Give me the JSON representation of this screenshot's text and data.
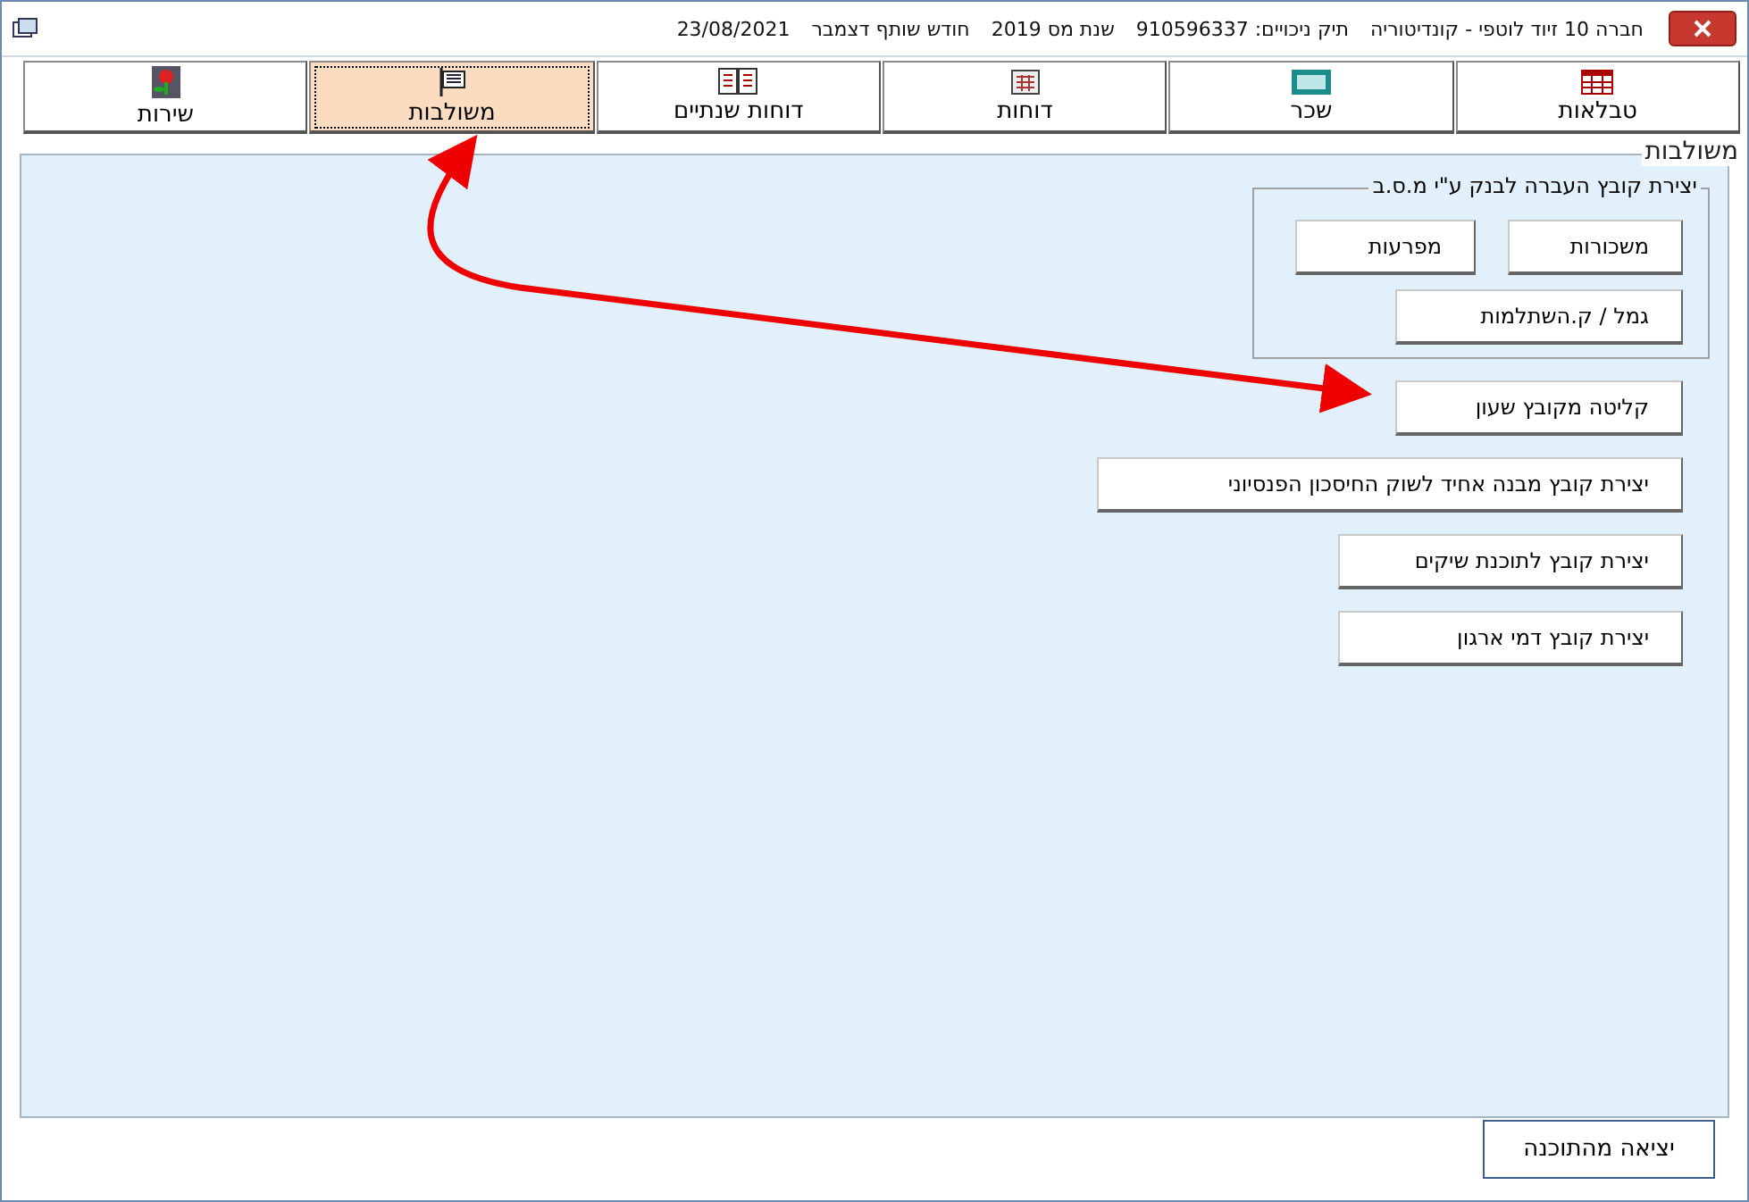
{
  "window": {
    "title_parts": [
      "חברה 10 זיוד לוטפי - קונדיטוריה",
      "תיק ניכויים: 910596337",
      "שנת מס 2019",
      "חודש שותף דצמבר",
      "23/08/2021"
    ]
  },
  "tabs": [
    {
      "label": "טבלאות",
      "selected": false
    },
    {
      "label": "שכר",
      "selected": false
    },
    {
      "label": "דוחות",
      "selected": false
    },
    {
      "label": "דוחות שנתיים",
      "selected": false
    },
    {
      "label": "משולבות",
      "selected": true
    },
    {
      "label": "שירות",
      "selected": false
    }
  ],
  "panel": {
    "title": "משולבות",
    "bank_group": {
      "title": "יצירת קובץ העברה לבנק ע\"י מ.ס.ב",
      "buttons": [
        "משכורות",
        "מפרעות",
        "גמל / ק.השתלמות"
      ]
    },
    "buttons": [
      "קליטה מקובץ שעון",
      "יצירת קובץ מבנה אחיד לשוק החיסכון הפנסיוני",
      "יצירת קובץ לתוכנת שיקים",
      "יצירת קובץ דמי ארגון"
    ]
  },
  "exit_button": "יציאה מהתוכנה"
}
